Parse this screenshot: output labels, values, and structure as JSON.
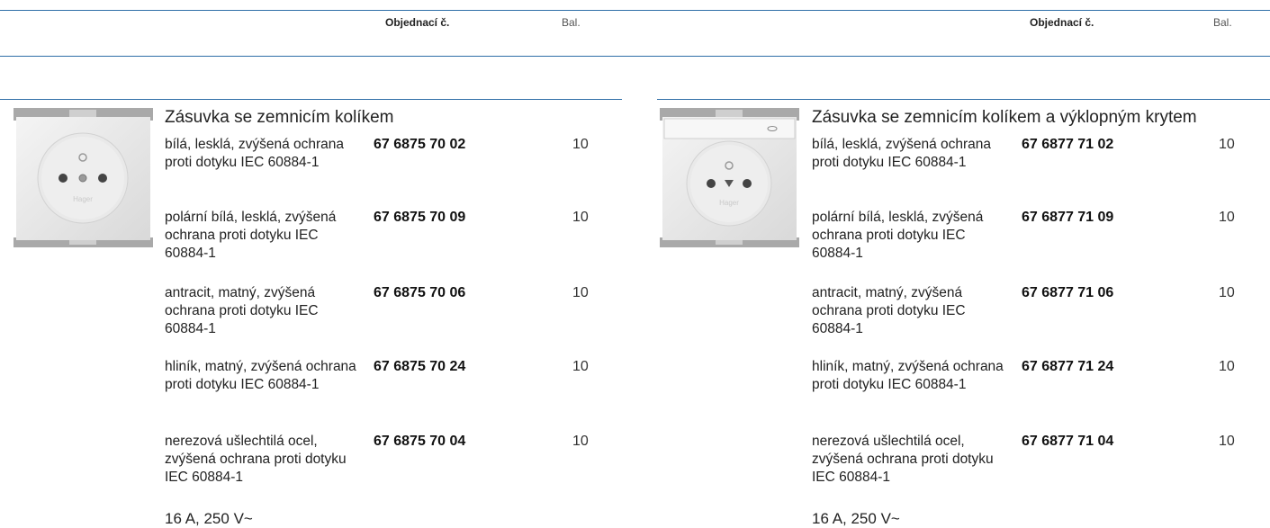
{
  "header": {
    "left": {
      "order_no_label": "Objednací č.",
      "pack_label": "Bal."
    },
    "right": {
      "order_no_label": "Objednací č.",
      "pack_label": "Bal."
    }
  },
  "left_product": {
    "title": "Zásuvka se zemnicím kolíkem",
    "image": "socket-with-earth-pin",
    "rows": [
      {
        "desc": "bílá, lesklá, zvýšená ochrana proti dotyku IEC 60884-1",
        "code": "67 6875 70 02",
        "pack": "10"
      },
      {
        "desc": "polární bílá, lesklá, zvýšená ochrana proti dotyku IEC 60884-1",
        "code": "67 6875 70 09",
        "pack": "10"
      },
      {
        "desc": "antracit, matný, zvýšená ochrana proti dotyku IEC 60884-1",
        "code": "67 6875 70 06",
        "pack": "10"
      },
      {
        "desc": "hliník, matný, zvýšená ochrana proti dotyku IEC 60884-1",
        "code": "67 6875 70 24",
        "pack": "10"
      },
      {
        "desc": "nerezová ušlechtilá ocel, zvýšená ochrana proti dotyku IEC 60884-1",
        "code": "67 6875 70 04",
        "pack": "10"
      }
    ],
    "rating": "16 A, 250 V~"
  },
  "right_product": {
    "title": "Zásuvka se zemnicím kolíkem a výklopným krytem",
    "image": "socket-with-earth-pin-and-hinged-cover",
    "rows": [
      {
        "desc": "bílá, lesklá, zvýšená ochrana proti dotyku IEC 60884-1",
        "code": "67 6877 71 02",
        "pack": "10"
      },
      {
        "desc": "polární bílá, lesklá, zvýšená ochrana proti dotyku IEC 60884-1",
        "code": "67 6877 71 09",
        "pack": "10"
      },
      {
        "desc": "antracit, matný, zvýšená ochrana proti dotyku IEC 60884-1",
        "code": "67 6877 71 06",
        "pack": "10"
      },
      {
        "desc": "hliník, matný, zvýšená ochrana proti dotyku IEC 60884-1",
        "code": "67 6877 71 24",
        "pack": "10"
      },
      {
        "desc": "nerezová ušlechtilá ocel, zvýšená ochrana proti dotyku IEC 60884-1",
        "code": "67 6877 71 04",
        "pack": "10"
      }
    ],
    "rating": "16 A, 250 V~"
  },
  "colors": {
    "rule": "#2f6fa8",
    "text": "#1a1a1a"
  }
}
